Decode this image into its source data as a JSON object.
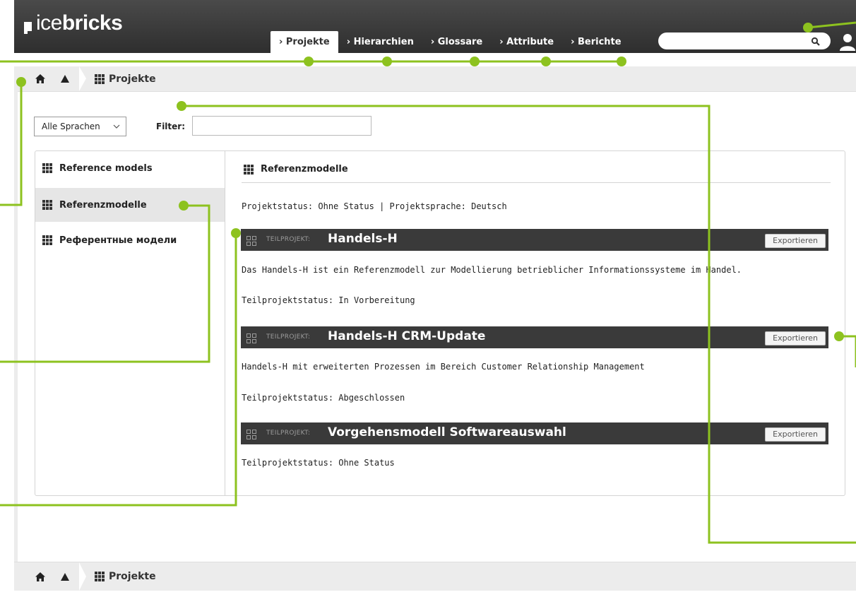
{
  "app": {
    "logo_prefix": "ice",
    "logo_suffix": "bricks"
  },
  "nav": {
    "tabs": [
      {
        "label": "› Projekte",
        "active": true
      },
      {
        "label": "› Hierarchien"
      },
      {
        "label": "› Glossare"
      },
      {
        "label": "› Attribute"
      },
      {
        "label": "› Berichte"
      }
    ]
  },
  "search": {
    "placeholder": "",
    "icon": "search-icon"
  },
  "breadcrumb": {
    "home_icon": "home-icon",
    "up_icon": "up-arrow-icon",
    "label": "Projekte"
  },
  "filters": {
    "language_selected": "Alle Sprachen",
    "filter_label": "Filter:",
    "filter_value": ""
  },
  "sidebar": {
    "items": [
      {
        "label": "Reference models"
      },
      {
        "label": "Referenzmodelle",
        "selected": true
      },
      {
        "label": "Референтные модели"
      }
    ]
  },
  "content": {
    "title": "Referenzmodelle",
    "project_status": "Projektstatus: Ohne Status | Projektsprache: Deutsch",
    "subprojects": [
      {
        "type_label": "TEILPROJEKT:",
        "title": "Handels-H",
        "export_label": "Exportieren",
        "description": "Das Handels-H ist ein Referenzmodell zur Modellierung betrieblicher Informationssysteme im Handel.",
        "status": "Teilprojektstatus: In Vorbereitung"
      },
      {
        "type_label": "TEILPROJEKT:",
        "title": "Handels-H CRM-Update",
        "export_label": "Exportieren",
        "description": "Handels-H mit erweiterten Prozessen im Bereich Customer Relationship Management",
        "status": "Teilprojektstatus: Abgeschlossen"
      },
      {
        "type_label": "TEILPROJEKT:",
        "title": "Vorgehensmodell Softwareauswahl",
        "export_label": "Exportieren",
        "status": "Teilprojektstatus: Ohne Status"
      }
    ]
  },
  "colors": {
    "header": "#3a3a3a",
    "annotation": "#8dc21f",
    "subproject_bar": "#3a3a3a"
  }
}
